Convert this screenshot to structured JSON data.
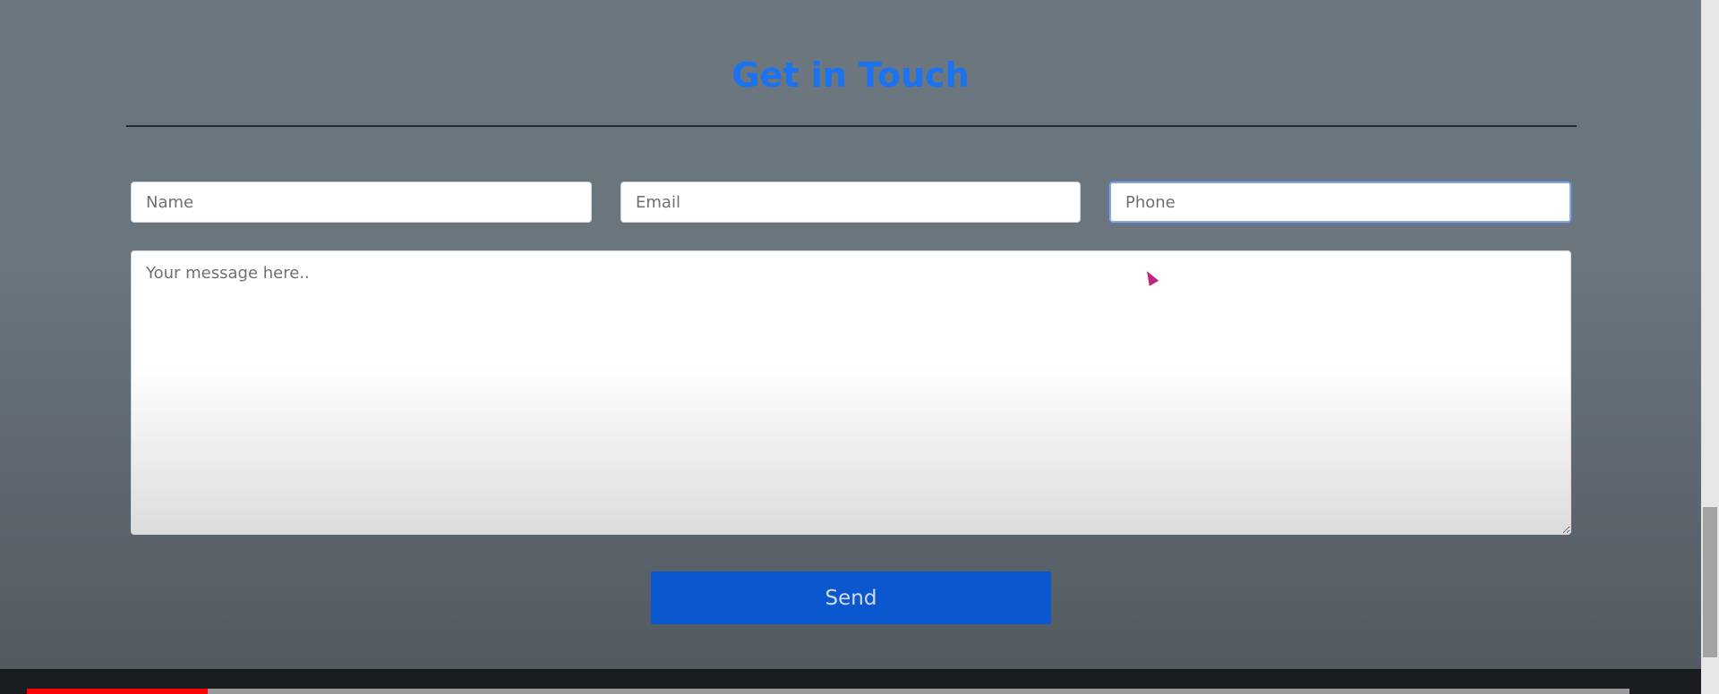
{
  "section": {
    "title": "Get in Touch"
  },
  "form": {
    "name_placeholder": "Name",
    "email_placeholder": "Email",
    "phone_placeholder": "Phone",
    "message_placeholder": "Your message here..",
    "send_label": "Send"
  },
  "video": {
    "progress_percent": 11.3
  },
  "colors": {
    "accent": "#1a73f0",
    "button": "#0b57d0",
    "progress": "#ff0000"
  }
}
